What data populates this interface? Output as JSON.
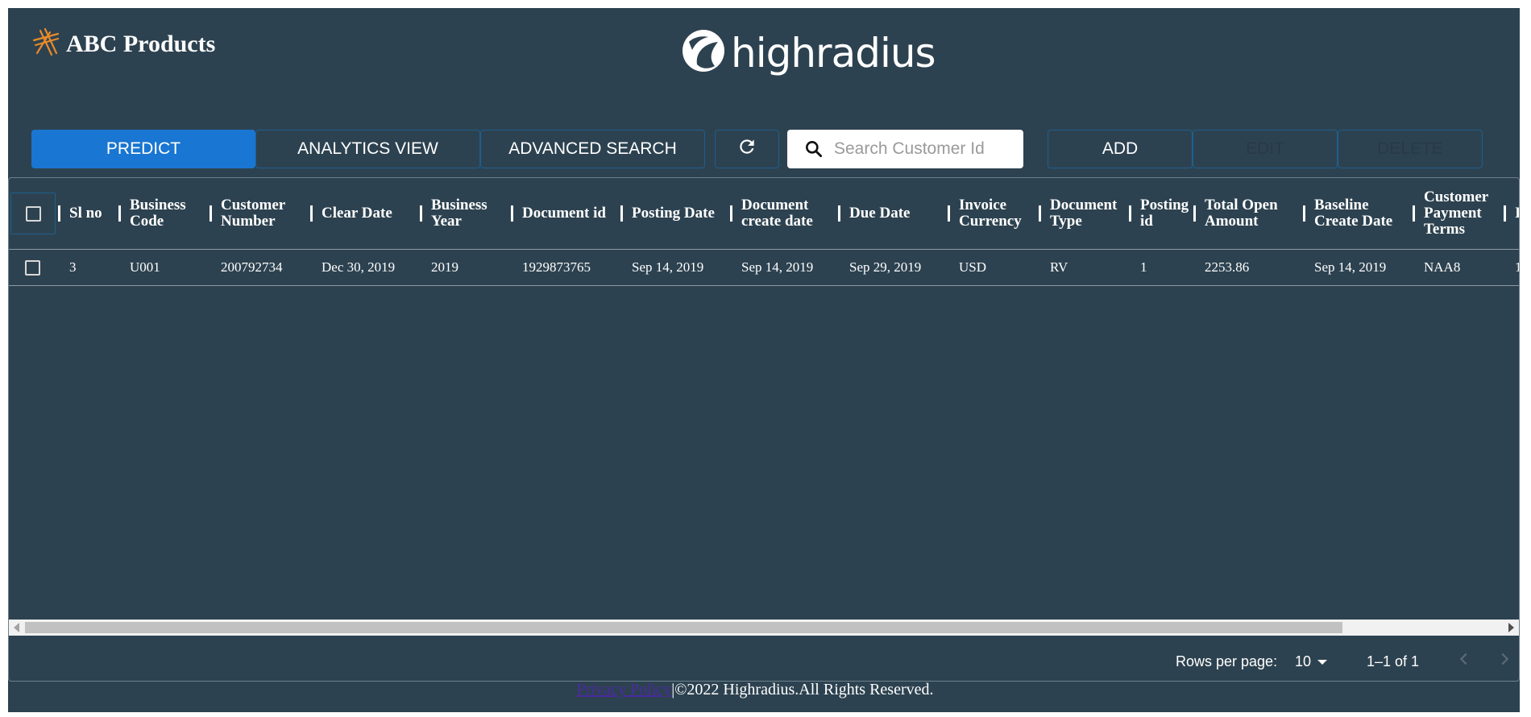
{
  "brand": {
    "title": "ABC Products",
    "logo_icon": "abc-logo-icon"
  },
  "highradius": {
    "text": "highradius",
    "icon": "highradius-swirl-icon"
  },
  "toolbar": {
    "predict": "PREDICT",
    "analytics": "ANALYTICS VIEW",
    "advanced_search": "ADVANCED SEARCH",
    "refresh_icon": "refresh-icon",
    "search_placeholder": "Search Customer Id",
    "add": "ADD",
    "edit": "EDIT",
    "delete": "DELETE"
  },
  "table": {
    "headers": [
      "Sl no",
      "Business Code",
      "Customer Number",
      "Clear Date",
      "Business Year",
      "Document id",
      "Posting Date",
      "Document create date",
      "Due Date",
      "Invoice Currency",
      "Document Type",
      "Posting id",
      "Total Open Amount",
      "Baseline Create Date",
      "Customer Payment Terms",
      "I"
    ],
    "rows": [
      [
        "3",
        "U001",
        "200792734",
        "Dec 30, 2019",
        "2019",
        "1929873765",
        "Sep 14, 2019",
        "Sep 14, 2019",
        "Sep 29, 2019",
        "USD",
        "RV",
        "1",
        "2253.86",
        "Sep 14, 2019",
        "NAA8",
        "1"
      ]
    ]
  },
  "pagination": {
    "rows_per_page_label": "Rows per page:",
    "rows_per_page": "10",
    "range": "1–1 of 1"
  },
  "footer": {
    "privacy_link": "Privacy Policy",
    "copyright": "|©2022 Highradius.All Rights Reserved."
  },
  "colors": {
    "background": "#2d4250",
    "primary": "#1976d2",
    "accent": "#e88a2a"
  }
}
